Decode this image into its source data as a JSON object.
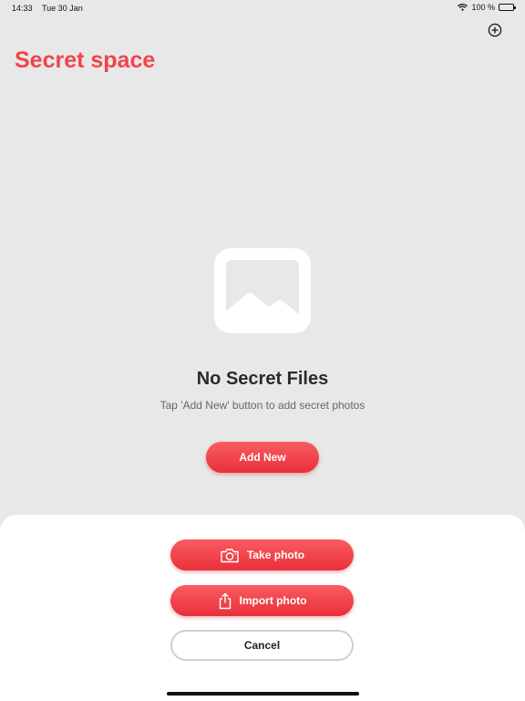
{
  "status_bar": {
    "time": "14:33",
    "date": "Tue 30 Jan",
    "battery": "100 %",
    "icons": [
      "wifi-icon",
      "battery-icon"
    ]
  },
  "header": {
    "title": "Secret space",
    "add_icon": "plus-circle-icon"
  },
  "empty_state": {
    "icon": "image-placeholder-icon",
    "title": "No Secret Files",
    "subtitle": "Tap 'Add New' button to add secret photos",
    "button_label": "Add New"
  },
  "action_sheet": {
    "take_photo": {
      "label": "Take photo",
      "icon": "camera-icon"
    },
    "import_photo": {
      "label": "Import photo",
      "icon": "share-upload-icon"
    },
    "cancel": {
      "label": "Cancel"
    }
  },
  "colors": {
    "accent": "#f2444a",
    "background": "#e8e8e8",
    "sheet": "#ffffff"
  }
}
